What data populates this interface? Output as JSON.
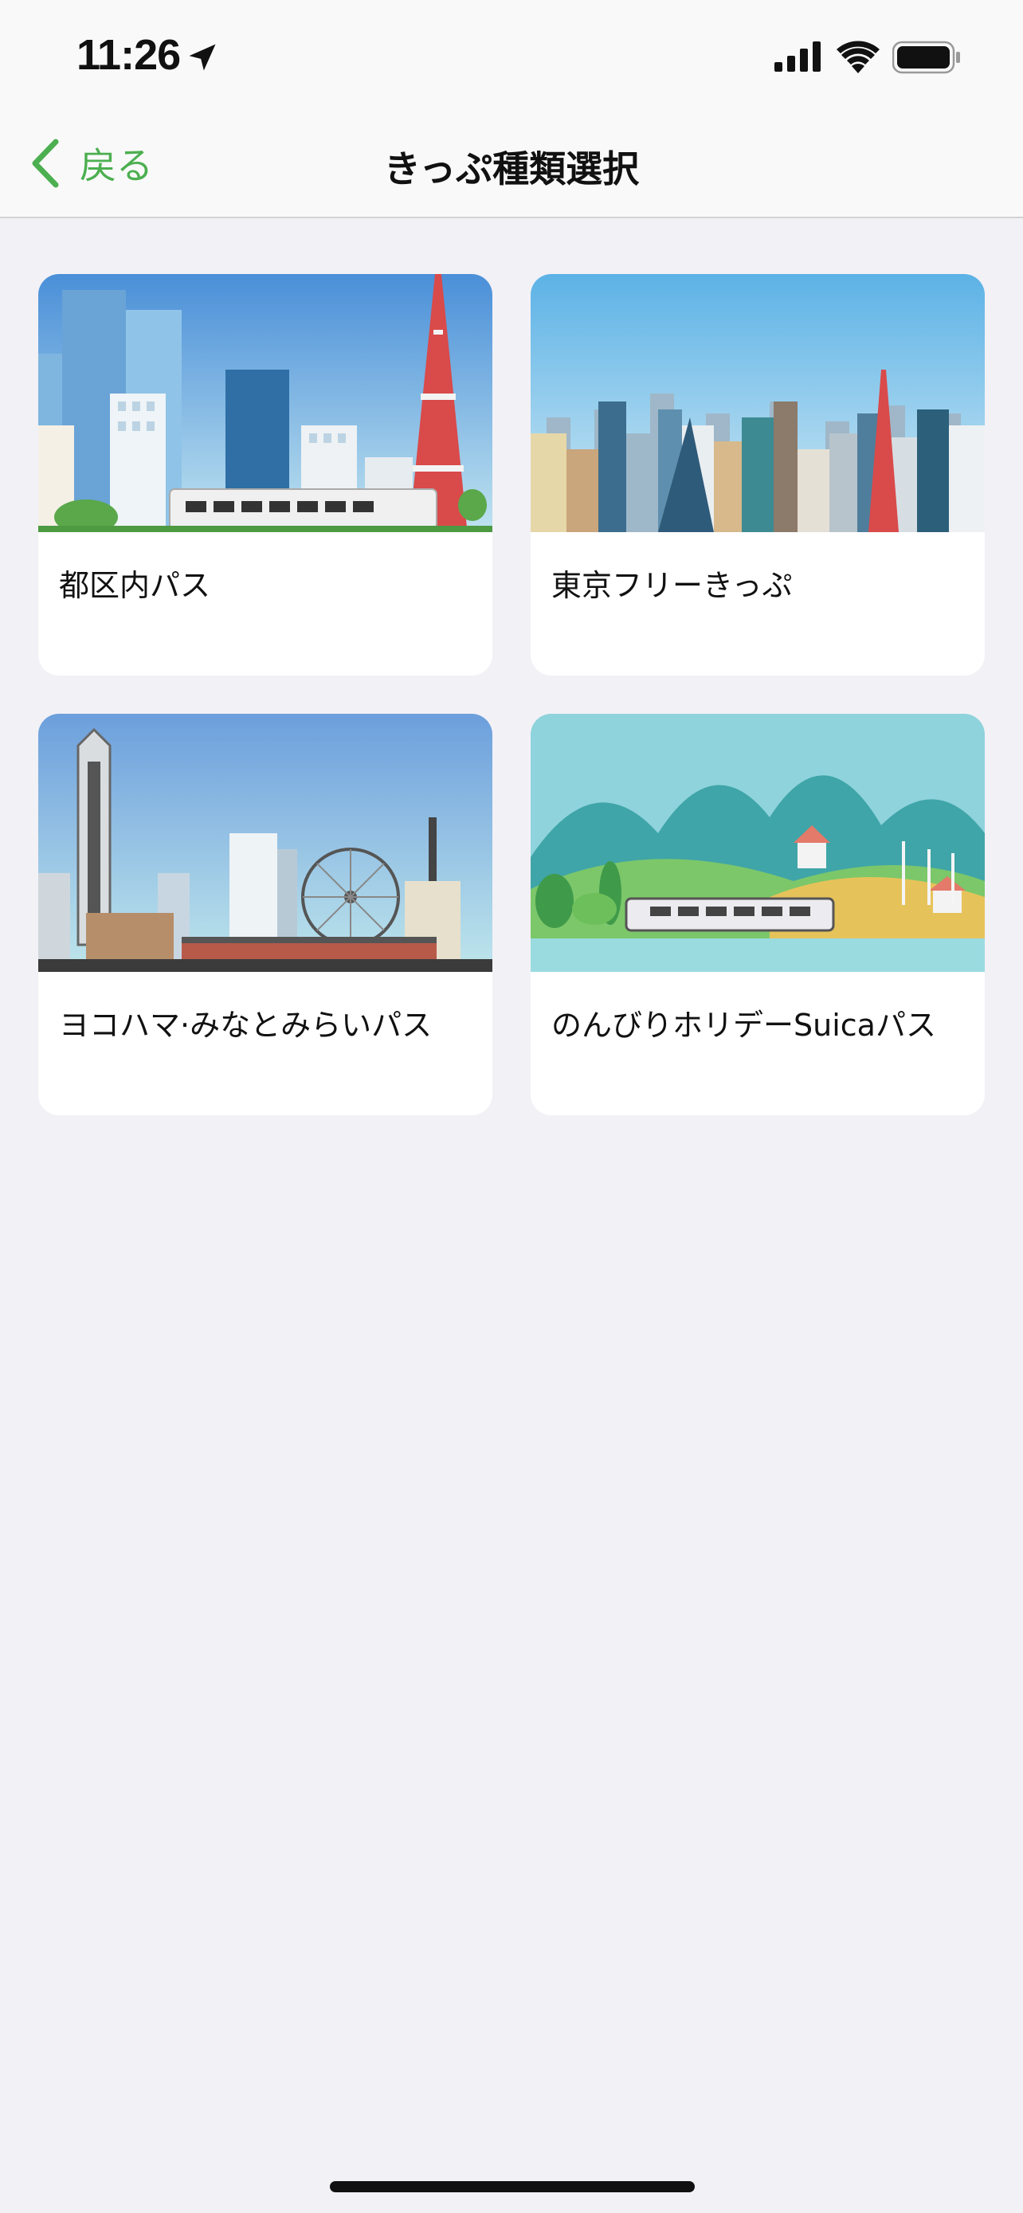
{
  "status_bar": {
    "time": "11:26",
    "icons": [
      "location-arrow-icon",
      "cellular-signal-icon",
      "wifi-icon",
      "battery-icon"
    ]
  },
  "nav": {
    "back_label": "戻る",
    "title": "きっぷ種類選択",
    "accent_color": "#4caf50"
  },
  "cards": [
    {
      "label": "都区内パス",
      "image": "tokyo-tower-city-illustration"
    },
    {
      "label": "東京フリーきっぷ",
      "image": "tokyo-skyline-illustration"
    },
    {
      "label": "ヨコハマ·みなとみらいパス",
      "image": "yokohama-minatomirai-illustration"
    },
    {
      "label": "のんびりホリデーSuicaパス",
      "image": "countryside-train-illustration"
    }
  ]
}
